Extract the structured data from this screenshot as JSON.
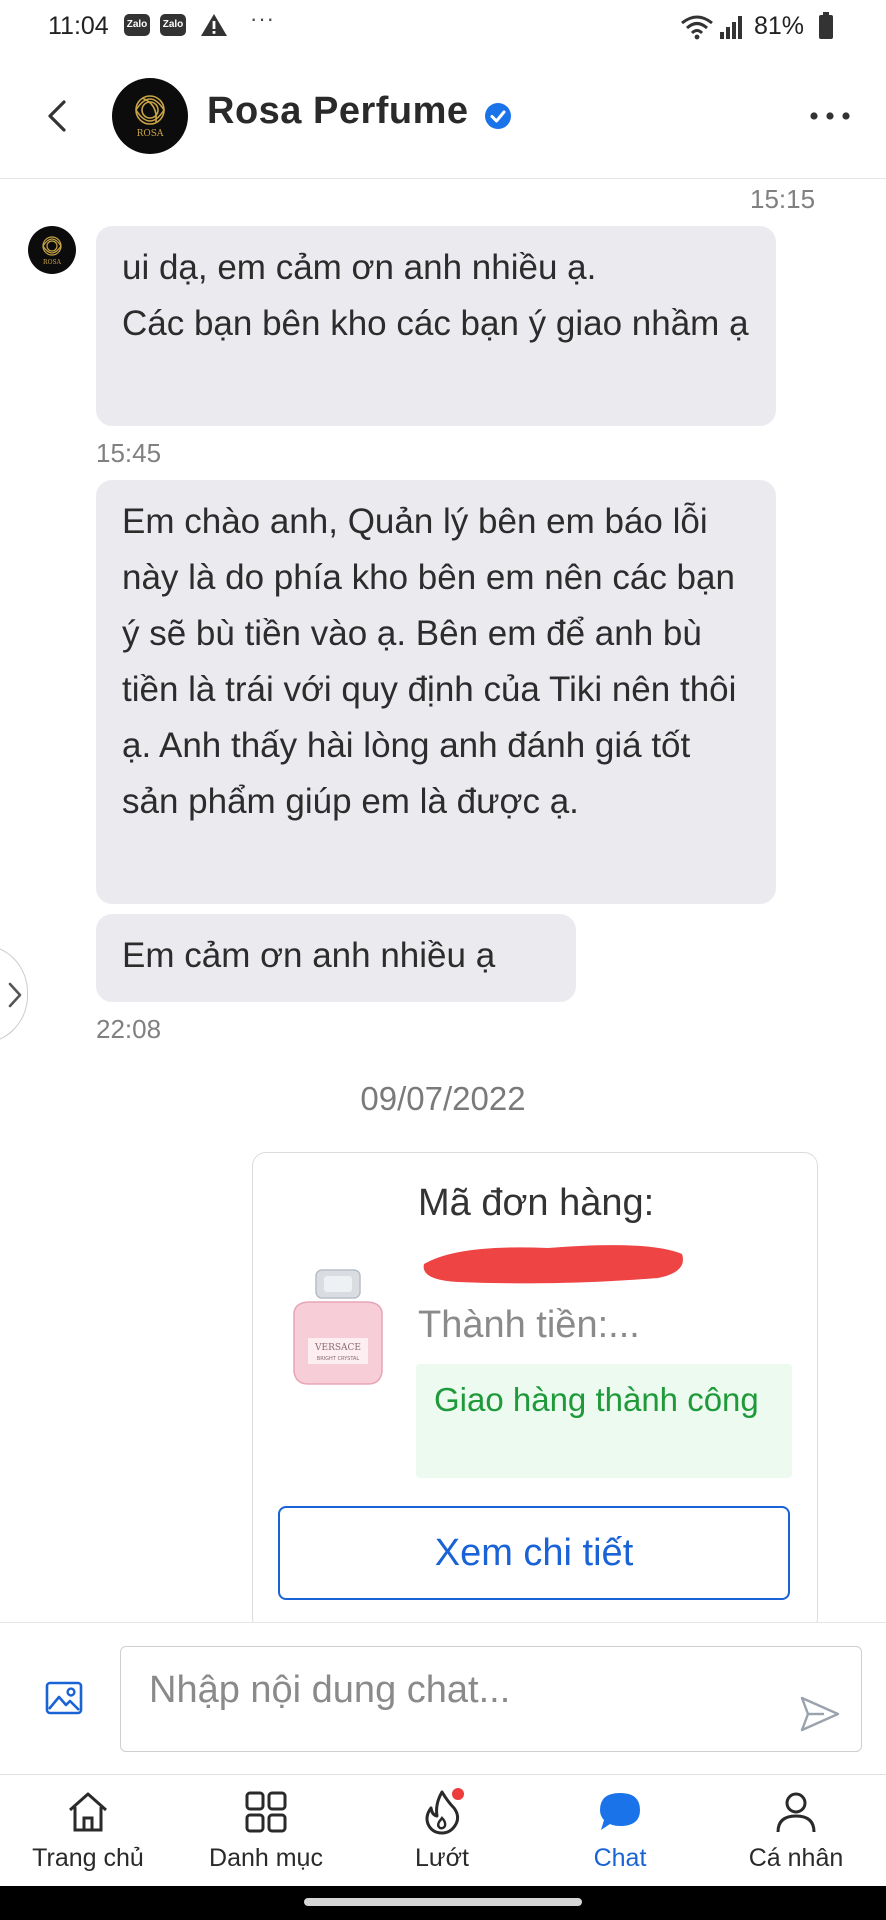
{
  "status_bar": {
    "time": "11:04",
    "notification_icons": [
      "Zalo",
      "Zalo"
    ],
    "more": "···",
    "battery": "81%"
  },
  "header": {
    "shop_name": "Rosa Perfume",
    "avatar_text": "ROSA"
  },
  "messages": [
    {
      "type": "timestamp",
      "text": "15:15"
    },
    {
      "type": "bubble",
      "text": "ui dạ, em cảm ơn anh nhiều ạ.\nCác bạn bên kho các bạn ý giao nhầm ạ"
    },
    {
      "type": "timestamp",
      "text": "15:45"
    },
    {
      "type": "bubble",
      "text": "Em chào anh, Quản lý bên em báo lỗi này là do phía kho bên em nên các bạn ý sẽ bù tiền vào ạ. Bên em để anh bù tiền là trái với quy định của Tiki nên thôi ạ. Anh thấy hài lòng anh đánh giá tốt sản phẩm giúp em là được ạ."
    },
    {
      "type": "bubble",
      "text": "Em cảm ơn anh nhiều ạ"
    },
    {
      "type": "timestamp",
      "text": "22:08"
    }
  ],
  "date_separator": "09/07/2022",
  "order_card": {
    "order_label": "Mã đơn hàng:",
    "amount_label": "Thành tiền:...",
    "status": "Giao hàng thành công",
    "detail_button": "Xem chi tiết",
    "product_brand": "VERSACE",
    "product_sub": "BRIGHT CRYSTAL"
  },
  "input": {
    "placeholder": "Nhập nội dung chat..."
  },
  "bottom_nav": [
    {
      "label": "Trang chủ",
      "icon": "home-icon"
    },
    {
      "label": "Danh mục",
      "icon": "grid-icon"
    },
    {
      "label": "Lướt",
      "icon": "flame-icon"
    },
    {
      "label": "Chat",
      "icon": "chat-icon",
      "active": true
    },
    {
      "label": "Cá nhân",
      "icon": "person-icon"
    }
  ],
  "colors": {
    "accent": "#1a63d6",
    "success": "#1f9a3a",
    "bubble": "#ebebef"
  }
}
